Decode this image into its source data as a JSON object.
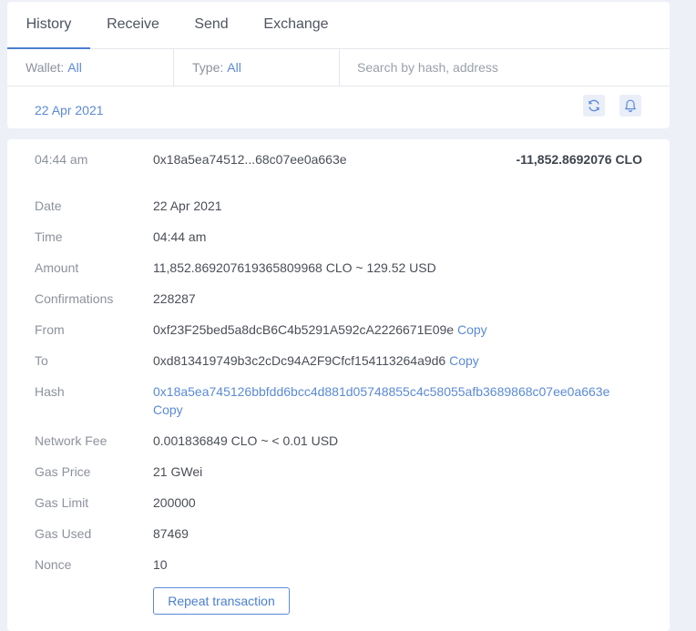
{
  "tabs": [
    "History",
    "Receive",
    "Send",
    "Exchange"
  ],
  "filters": {
    "wallet_label": "Wallet:",
    "wallet_value": "All",
    "type_label": "Type:",
    "type_value": "All",
    "search_placeholder": "Search by hash, address"
  },
  "date_header": "22 Apr 2021",
  "icons": {
    "refresh": "refresh-icon",
    "notifications": "bell-icon"
  },
  "transaction": {
    "summary": {
      "time": "04:44 am",
      "hash_short": "0x18a5ea74512...68c07ee0a663e",
      "amount": "-11,852.8692076 CLO"
    },
    "details": {
      "date": {
        "label": "Date",
        "value": "22 Apr 2021"
      },
      "time": {
        "label": "Time",
        "value": "04:44 am"
      },
      "amount": {
        "label": "Amount",
        "value": "11,852.869207619365809968 CLO ~ 129.52 USD"
      },
      "confirmations": {
        "label": "Confirmations",
        "value": "228287"
      },
      "from": {
        "label": "From",
        "value": "0xf23F25bed5a8dcB6C4b5291A592cA2226671E09e"
      },
      "to": {
        "label": "To",
        "value": "0xd813419749b3c2cDc94A2F9Cfcf154113264a9d6"
      },
      "hash": {
        "label": "Hash",
        "value": "0x18a5ea745126bbfdd6bcc4d881d05748855c4c58055afb3689868c07ee0a663e"
      },
      "network_fee": {
        "label": "Network Fee",
        "value": "0.001836849 CLO ~ < 0.01 USD"
      },
      "gas_price": {
        "label": "Gas Price",
        "value": "21 GWei"
      },
      "gas_limit": {
        "label": "Gas Limit",
        "value": "200000"
      },
      "gas_used": {
        "label": "Gas Used",
        "value": "87469"
      },
      "nonce": {
        "label": "Nonce",
        "value": "10"
      }
    },
    "copy_label": "Copy",
    "repeat_button": "Repeat transaction"
  },
  "colors": {
    "accent": "#5b8ad6",
    "background": "#eef0f8",
    "panel": "#ffffff",
    "label": "#8c929c",
    "text": "#4a4f57"
  }
}
